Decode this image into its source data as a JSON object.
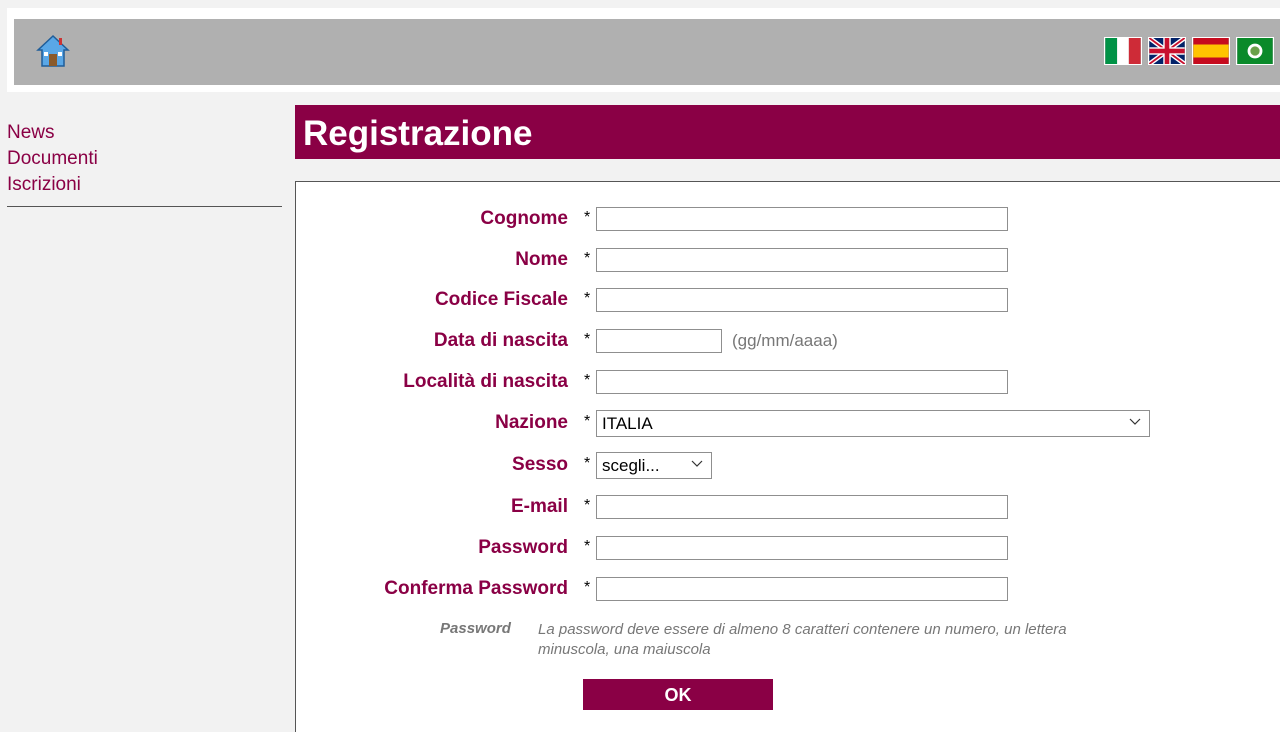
{
  "header": {
    "home_icon": "home-icon",
    "flags": [
      {
        "name": "italian-flag",
        "lang": "it"
      },
      {
        "name": "uk-flag",
        "lang": "en"
      },
      {
        "name": "spanish-flag",
        "lang": "es"
      },
      {
        "name": "emblem-flag",
        "lang": "other"
      }
    ]
  },
  "sidebar": {
    "items": [
      {
        "label": "News"
      },
      {
        "label": "Documenti"
      },
      {
        "label": "Iscrizioni"
      }
    ]
  },
  "page": {
    "title": "Registrazione"
  },
  "form": {
    "required_mark": "*",
    "fields": {
      "cognome": {
        "label": "Cognome",
        "value": ""
      },
      "nome": {
        "label": "Nome",
        "value": ""
      },
      "codice_fiscale": {
        "label": "Codice Fiscale",
        "value": ""
      },
      "data_nascita": {
        "label": "Data di nascita",
        "value": "",
        "hint": "(gg/mm/aaaa)"
      },
      "localita_nascita": {
        "label": "Località di nascita",
        "value": ""
      },
      "nazione": {
        "label": "Nazione",
        "selected": "ITALIA"
      },
      "sesso": {
        "label": "Sesso",
        "selected": "scegli..."
      },
      "email": {
        "label": "E-mail",
        "value": ""
      },
      "password": {
        "label": "Password",
        "value": ""
      },
      "conferma_password": {
        "label": "Conferma Password",
        "value": ""
      }
    },
    "password_note": {
      "label": "Password",
      "text": "La password deve essere di almeno 8 caratteri contenere un numero, un lettera minuscola, una maiuscola"
    },
    "submit_label": "OK"
  },
  "colors": {
    "brand": "#8a0045",
    "header_bg": "#b0b0b0",
    "page_bg": "#f2f2f2"
  }
}
